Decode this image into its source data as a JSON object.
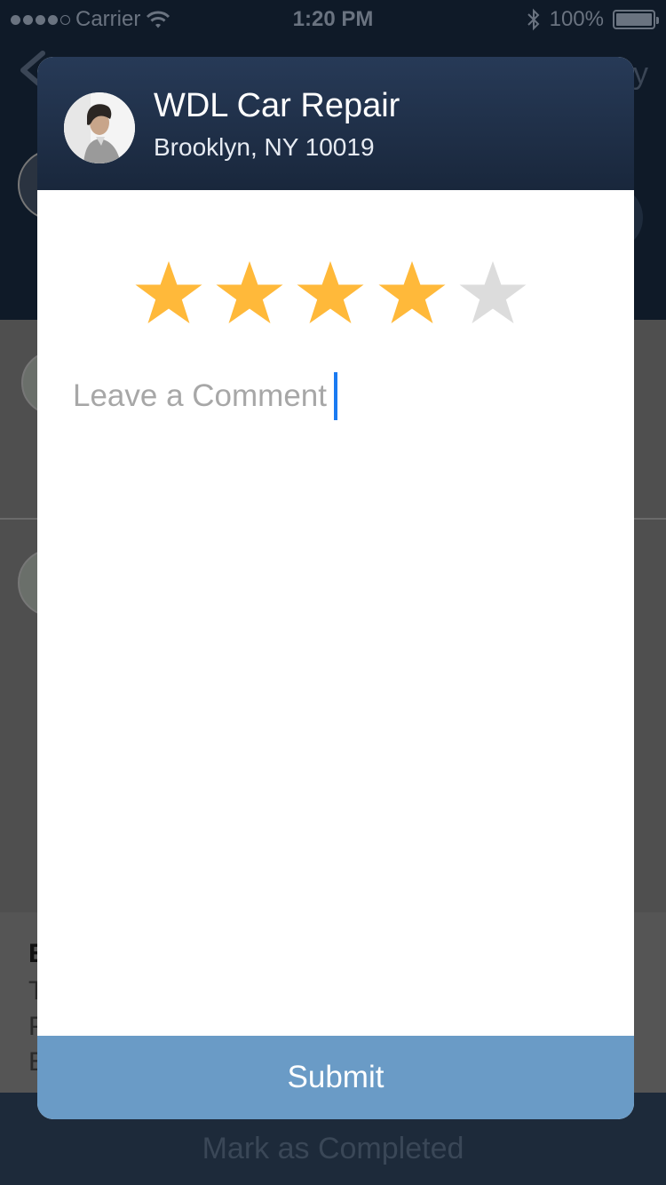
{
  "status_bar": {
    "carrier": "Carrier",
    "time": "1:20 PM",
    "battery": "100%"
  },
  "background": {
    "header_right_text": "y",
    "footer_letters": [
      "E",
      "T",
      "P",
      "E"
    ],
    "bottom_action": "Mark as Completed"
  },
  "modal": {
    "title": "WDL Car Repair",
    "subtitle": "Brooklyn, NY 10019",
    "rating": {
      "value": 4,
      "max": 5
    },
    "comment_placeholder": "Leave a Comment",
    "submit_label": "Submit"
  },
  "colors": {
    "star_filled": "#FFB93A",
    "star_empty": "#DCDCDC",
    "header": "#1F2F47",
    "submit": "#6A9BC6",
    "cursor": "#1A7BF2"
  },
  "icons": [
    "back-chevron-icon",
    "wifi-icon",
    "bluetooth-icon",
    "battery-icon",
    "star-icon"
  ]
}
